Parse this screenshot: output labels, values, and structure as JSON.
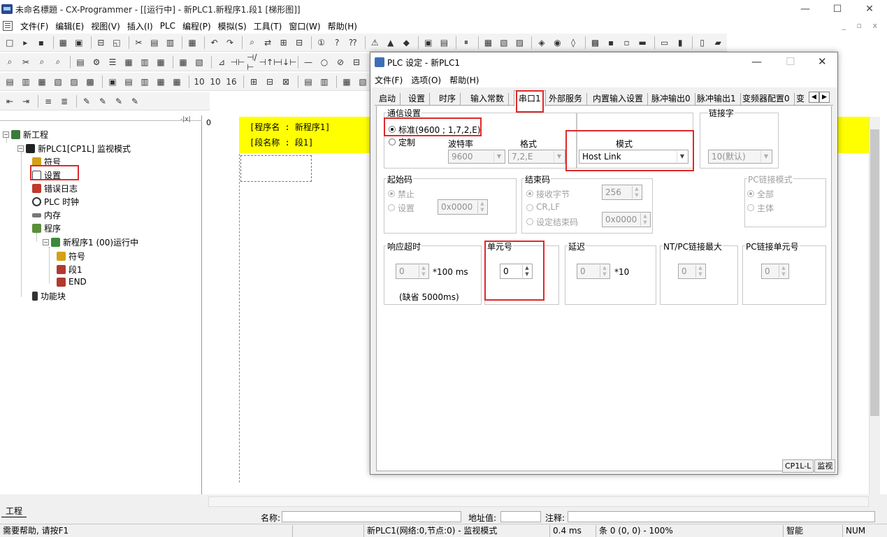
{
  "window": {
    "title": "未命名標題 - CX-Programmer - [[运行中] - 新PLC1.新程序1.段1 [梯形图]]",
    "controls": [
      "—",
      "☐",
      "✕"
    ]
  },
  "menu": [
    "文件(F)",
    "编辑(E)",
    "视图(V)",
    "插入(I)",
    "PLC",
    "编程(P)",
    "模拟(S)",
    "工具(T)",
    "窗口(W)",
    "帮助(H)"
  ],
  "mdi_controls": "_ ▫ x",
  "toolbars": [
    [
      "□",
      "▸",
      "▪",
      "|",
      "▦",
      "▣",
      "|",
      "⊟",
      "◱",
      "|",
      "✂",
      "▤",
      "▥",
      "|",
      "▦",
      "|",
      "↶",
      "↷",
      "|",
      "⌕",
      "⇄",
      "⊞",
      "⊟",
      "|",
      "①",
      "?",
      "⁇",
      "|",
      "⚠",
      "▲",
      "◆",
      "|",
      "▣",
      "▤",
      "|",
      "⏸",
      "|",
      "▦",
      "▧",
      "▨",
      "|",
      "◈",
      "◉",
      "◊",
      "|",
      "▩",
      "▪",
      "▫",
      "▬",
      "|",
      "▭",
      "▮",
      "|",
      "▯",
      "▰"
    ],
    [
      "⌕",
      "✂",
      "⌕",
      "⌕",
      "|",
      "▤",
      "⚙",
      "☰",
      "▦",
      "▥",
      "▦",
      "|",
      "▦",
      "▧",
      "|",
      "⊿",
      "⊣⊢",
      "⊣/⊢",
      "⊣↑⊢",
      "⊣↓⊢",
      "|",
      "—",
      "○",
      "⊘",
      "⊟"
    ],
    [
      "▤",
      "▥",
      "▦",
      "▧",
      "▨",
      "▩",
      "|",
      "▣",
      "▤",
      "▥",
      "▦",
      "▦",
      "|",
      "10",
      "10",
      "16",
      "|",
      "⊞",
      "⊟",
      "⊠",
      "|",
      "▤",
      "▥",
      "|",
      "▦",
      "▧"
    ],
    [
      "⇤",
      "⇥",
      "|",
      "≡",
      "≣",
      "|",
      "✎",
      "✎",
      "✎",
      "✎"
    ]
  ],
  "tree": {
    "items": [
      {
        "label": "新工程",
        "icon": "project-icon"
      },
      {
        "label": "新PLC1[CP1L] 监视模式",
        "icon": "plc-icon"
      },
      {
        "label": "符号",
        "icon": "symbols-icon"
      },
      {
        "label": "设置",
        "icon": "settings-icon"
      },
      {
        "label": "错误日志",
        "icon": "error-log-icon"
      },
      {
        "label": "PLC 时钟",
        "icon": "clock-icon"
      },
      {
        "label": "内存",
        "icon": "memory-icon"
      },
      {
        "label": "程序",
        "icon": "programs-icon"
      },
      {
        "label": "新程序1 (00)运行中",
        "icon": "program-icon"
      },
      {
        "label": "符号",
        "icon": "symbols-icon"
      },
      {
        "label": "段1",
        "icon": "section-icon"
      },
      {
        "label": "END",
        "icon": "section-icon"
      },
      {
        "label": "功能块",
        "icon": "function-block-icon"
      }
    ],
    "close_label": "-|x|"
  },
  "ladder": {
    "rung_number": "0",
    "program_name": "[程序名 : 新程序1]",
    "section_name": "[段名称 : 段1]"
  },
  "bottom": {
    "tab_label": "工程",
    "name_label": "名称:",
    "address_label": "地址值:",
    "comment_label": "注释:"
  },
  "status": {
    "help": "需要帮助, 请按F1",
    "plc": "新PLC1(网络:0,节点:0) - 监视模式",
    "scan_time": "0.4 ms",
    "position": "条 0 (0, 0) - 100%",
    "mode": "智能",
    "num": "NUM"
  },
  "dialog": {
    "title": "PLC 设定 - 新PLC1",
    "controls": [
      "—",
      "☐",
      "✕"
    ],
    "menu": [
      "文件(F)",
      "选项(O)",
      "帮助(H)"
    ],
    "tabs": [
      "启动",
      "设置",
      "时序",
      "输入常数",
      "串口1",
      "外部服务",
      "内置输入设置",
      "脉冲输出0",
      "脉冲输出1",
      "变频器配置0",
      "变"
    ],
    "selected_tab": "串口1",
    "comm": {
      "group_label": "通信设置",
      "standard": "标准(9600 ; 1,7,2,E)",
      "custom": "定制",
      "baud_label": "波特率",
      "baud_value": "9600",
      "format_label": "格式",
      "format_value": "7,2,E"
    },
    "mode": {
      "label": "模式",
      "value": "Host Link"
    },
    "link_word": {
      "label": "链接字",
      "value": "10(默认)"
    },
    "start_code": {
      "label": "起始码",
      "disable": "禁止",
      "set": "设置",
      "value": "0x0000"
    },
    "end_code": {
      "label": "结束码",
      "recv_bytes": "接收字节",
      "bytes_value": "256",
      "crlf": "CR,LF",
      "set_end": "设定结束码",
      "value": "0x0000"
    },
    "pc_link_mode": {
      "label": "PC链接模式",
      "all": "全部",
      "master": "主体"
    },
    "response_timeout": {
      "label": "响应超时",
      "value": "0",
      "unit": "*100 ms",
      "default_note": "(缺省 5000ms)"
    },
    "unit_number": {
      "label": "单元号",
      "value": "0"
    },
    "delay": {
      "label": "延迟",
      "value": "0",
      "unit": "*10"
    },
    "nt_pc_max": {
      "label": "NT/PC链接最大",
      "value": "0"
    },
    "pc_link_unit": {
      "label": "PC链接单元号",
      "value": "0"
    },
    "status_model": "CP1L-L",
    "status_mode": "监视"
  },
  "colors": {
    "highlight": "#e0282a",
    "rung_bar": "#ffff00"
  }
}
